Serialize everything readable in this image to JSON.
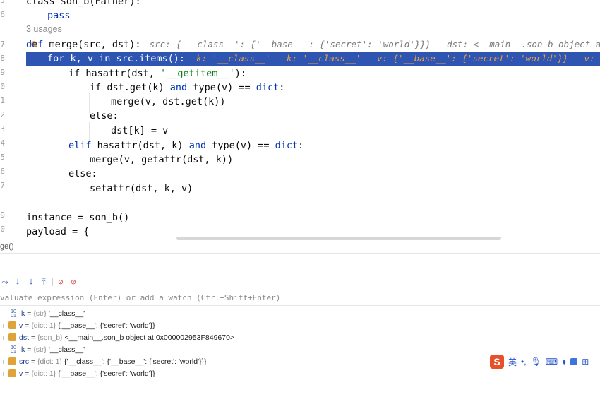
{
  "editor": {
    "line_numbers": [
      "5",
      "6",
      "",
      "7",
      "8",
      "9",
      "0",
      "1",
      "2",
      "3",
      "4",
      "5",
      "6",
      "7",
      "",
      "9",
      "0"
    ],
    "usages": "3 usages",
    "code": {
      "l_class": "class son_b(Father):",
      "l_pass": "pass",
      "l_def_kw": "def",
      "l_def_rest": " merge(src, dst):",
      "l_def_hint": "src: {'__class__': {'__base__': {'secret': 'world'}}}   dst: <__main__.son_b object a",
      "l_for": "for k, v in src.items():",
      "l_for_hint": "k: '__class__'   k: '__class__'   v: {'__base__': {'secret': 'world'}}   v:",
      "l_if1_a": "if hasattr(dst, ",
      "l_if1_str": "'__getitem__'",
      "l_if1_b": "):",
      "l_if2_a": "if dst.get(k) ",
      "l_if2_and": "and",
      "l_if2_b": " type(v) == ",
      "l_if2_dict": "dict",
      "l_if2_c": ":",
      "l_merge1": "merge(v, dst.get(k))",
      "l_else1": "else:",
      "l_assign": "dst[k] = v",
      "l_elif_a": "elif",
      "l_elif_b": " hasattr(dst, k) ",
      "l_elif_and": "and",
      "l_elif_c": " type(v) == ",
      "l_elif_dict": "dict",
      "l_elif_d": ":",
      "l_merge2": "merge(v, getattr(dst, k))",
      "l_else2": "else:",
      "l_setattr": "setattr(dst, k, v)",
      "l_instance": "instance = son_b()",
      "l_payload": "payload = {"
    }
  },
  "status": {
    "breadcrumb": "ge()"
  },
  "debugger": {
    "eval_placeholder": "valuate expression (Enter) or add a watch (Ctrl+Shift+Enter)",
    "variables": [
      {
        "name": "k",
        "type": "{str}",
        "value": "'__class__'",
        "expandable": false,
        "icon": "str-icon"
      },
      {
        "name": "v",
        "type": "{dict: 1}",
        "value": "{'__base__': {'secret': 'world'}}",
        "expandable": true,
        "icon": "dict-icon"
      },
      {
        "name": "dst",
        "type": "{son_b}",
        "value": "<__main__.son_b object at 0x000002953F849670>",
        "expandable": true,
        "icon": "object-icon"
      },
      {
        "name": "k",
        "type": "{str}",
        "value": "'__class__'",
        "expandable": false,
        "icon": "str-icon"
      },
      {
        "name": "src",
        "type": "{dict: 1}",
        "value": "{'__class__': {'__base__': {'secret': 'world'}}}",
        "expandable": true,
        "icon": "dict-icon"
      },
      {
        "name": "v",
        "type": "{dict: 1}",
        "value": "{'__base__': {'secret': 'world'}}",
        "expandable": true,
        "icon": "dict-icon"
      }
    ]
  },
  "ime": {
    "logo": "S",
    "lang": "英"
  },
  "colors": {
    "current_line": "#2f55b3",
    "keyword": "#0033b3",
    "string": "#067d17",
    "inline_hint": "#f0a040"
  }
}
